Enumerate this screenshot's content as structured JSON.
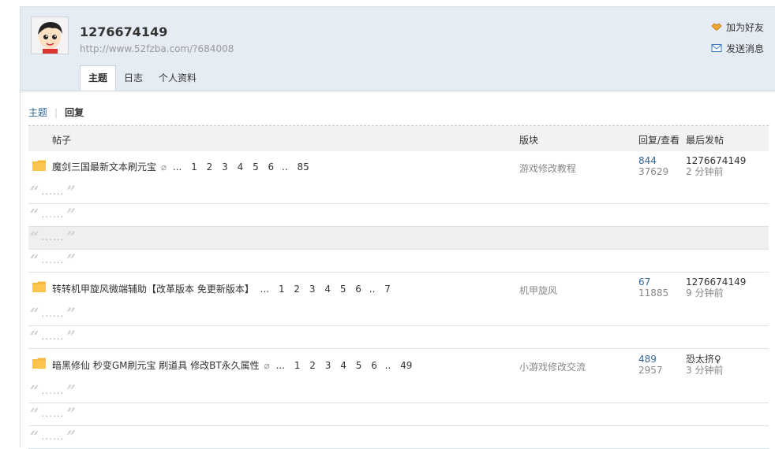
{
  "profile": {
    "username": "1276674149",
    "url": "http://www.52fzba.com/?684008",
    "avatar_icon": "cartoon-avatar-icon",
    "actions": [
      {
        "label": "加为好友",
        "icon": "handshake-icon"
      },
      {
        "label": "发送消息",
        "icon": "envelope-icon"
      }
    ],
    "tabs": [
      {
        "label": "主题",
        "active": true
      },
      {
        "label": "日志",
        "active": false
      },
      {
        "label": "个人资料",
        "active": false
      }
    ]
  },
  "subnav": {
    "topics": "主题",
    "separator": "|",
    "replies": "回复"
  },
  "table": {
    "headers": {
      "post": "帖子",
      "forum": "版块",
      "stats": "回复/查看",
      "last": "最后发帖"
    },
    "quote_text": "......",
    "threads": [
      {
        "title": "魔剑三国最新文本刷元宝",
        "attachment_icon": "paperclip-icon",
        "ellipsis": "...",
        "pages": [
          "1",
          "2",
          "3",
          "4",
          "5",
          "6",
          "85"
        ],
        "forum": "游戏修改教程",
        "replies": "844",
        "views": "37629",
        "last_user": "1276674149",
        "last_time": "2 分钟前"
      },
      {
        "title": "转转机甲旋风微端辅助【改革版本 免更新版本】",
        "attachment_icon": "",
        "ellipsis": "...",
        "pages": [
          "1",
          "2",
          "3",
          "4",
          "5",
          "6",
          "7"
        ],
        "forum": "机甲旋风",
        "replies": "67",
        "views": "11885",
        "last_user": "1276674149",
        "last_time": "9 分钟前"
      },
      {
        "title": "暗黑修仙 秒变GM刷元宝 刷道具 修改BT永久属性",
        "attachment_icon": "paperclip-icon",
        "ellipsis": "...",
        "pages": [
          "1",
          "2",
          "3",
          "4",
          "5",
          "6",
          "49"
        ],
        "forum": "小游戏修改交流",
        "replies": "489",
        "views": "2957",
        "last_user": "恐太挤♀",
        "last_time": "3 分钟前"
      }
    ]
  }
}
